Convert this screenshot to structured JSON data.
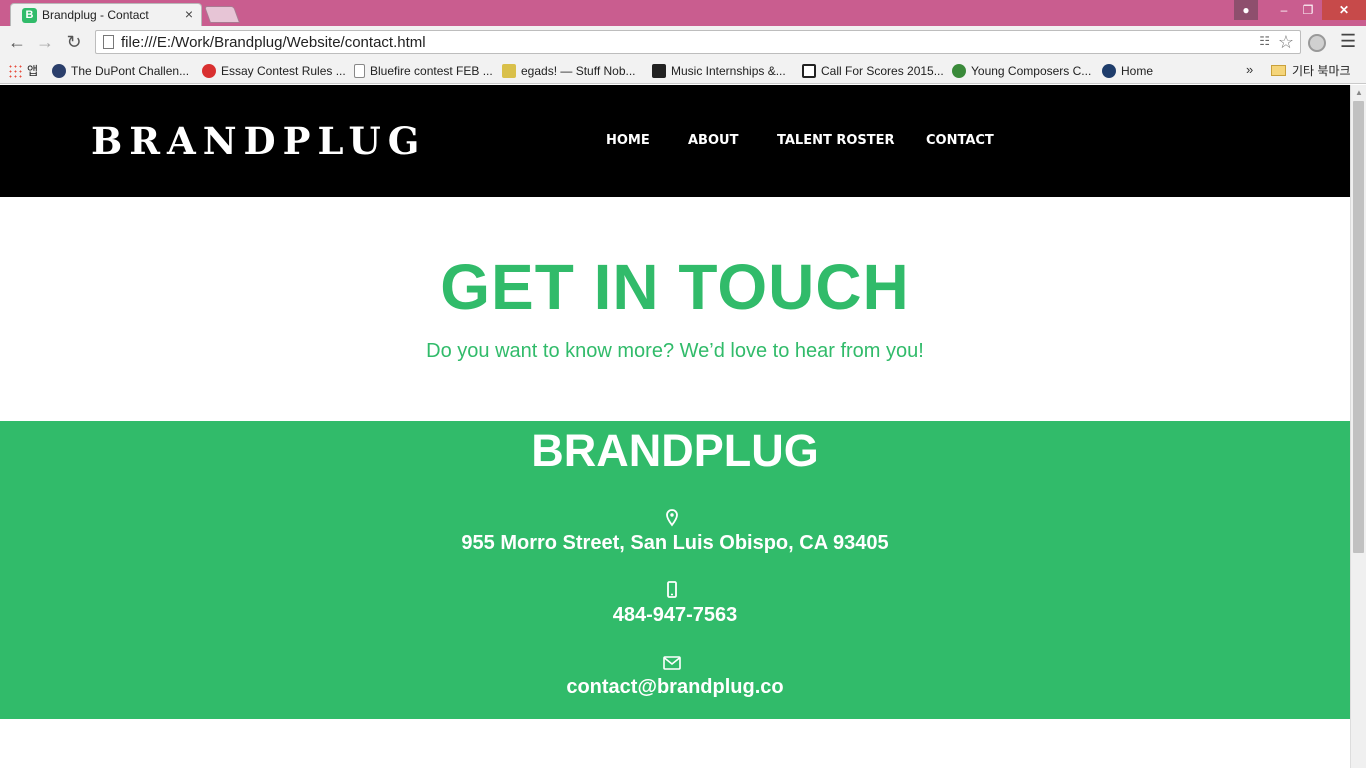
{
  "browser": {
    "tab": {
      "favicon_letter": "B",
      "title": "Brandplug - Contact",
      "close": "×"
    },
    "window": {
      "min": "–",
      "max": "❐",
      "close": "✕"
    },
    "url": "file:///E:/Work/Brandplug/Website/contact.html",
    "bookmarks": [
      {
        "label": "앱",
        "icon": "apps-grid-icon"
      },
      {
        "label": "The DuPont Challen...",
        "icon": "star-badge-icon"
      },
      {
        "label": "Essay Contest Rules ...",
        "icon": "red-flower-icon"
      },
      {
        "label": "Bluefire contest FEB ...",
        "icon": "page-icon"
      },
      {
        "label": "egads! — Stuff Nob...",
        "icon": "egads-icon"
      },
      {
        "label": "Music Internships &...",
        "icon": "music-icon"
      },
      {
        "label": "Call For Scores 2015...",
        "icon": "ib-icon"
      },
      {
        "label": "Young Composers C...",
        "icon": "composer-icon"
      },
      {
        "label": "Home",
        "icon": "kiwanis-icon"
      }
    ],
    "bookmarks_more": "»",
    "other_bookmarks": "기타 북마크"
  },
  "site": {
    "logo": "BRANDPLUG",
    "nav": [
      "HOME",
      "ABOUT",
      "TALENT ROSTER",
      "CONTACT"
    ]
  },
  "hero": {
    "title": "GET IN TOUCH",
    "subtitle": "Do you want to know more? We’d love to hear from you!"
  },
  "contact": {
    "title": "BRANDPLUG",
    "address": "955 Morro Street, San Luis Obispo, CA 93405",
    "phone": "484-947-7563",
    "email": "contact@brandplug.co"
  },
  "colors": {
    "brand_green": "#31bb6a",
    "header_black": "#000000",
    "chrome_frame": "#c95d8f"
  }
}
